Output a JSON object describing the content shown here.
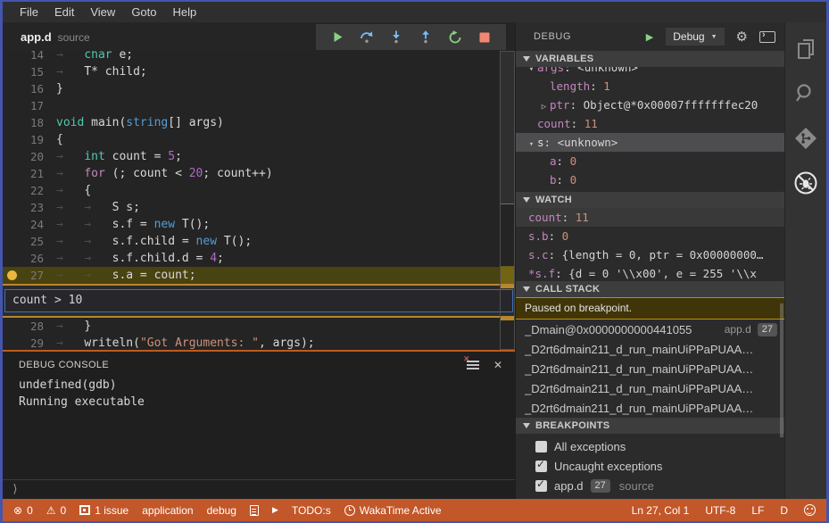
{
  "menu_bar": {
    "items": [
      "File",
      "Edit",
      "View",
      "Goto",
      "Help"
    ]
  },
  "editor": {
    "tab": {
      "title": "app.d",
      "type_label": "source"
    },
    "debug_toolbar": {
      "buttons": [
        "continue",
        "step-over",
        "step-into",
        "step-out",
        "restart",
        "stop"
      ]
    },
    "current_line": 27,
    "breakpoint_line": 27,
    "breakpoint_widget": {
      "condition": "count > 10",
      "after_line": 27
    },
    "code_lines": [
      {
        "num": 14,
        "tokens": [
          [
            "w",
            "→   "
          ],
          [
            "k",
            "char"
          ],
          [
            "p",
            " e;"
          ]
        ]
      },
      {
        "num": 15,
        "tokens": [
          [
            "w",
            "→   "
          ],
          [
            "p",
            "T* child;"
          ]
        ]
      },
      {
        "num": 16,
        "tokens": [
          [
            "p",
            "}"
          ]
        ]
      },
      {
        "num": 17,
        "tokens": []
      },
      {
        "num": 18,
        "tokens": [
          [
            "k",
            "void"
          ],
          [
            "p",
            " main("
          ],
          [
            "t",
            "string"
          ],
          [
            "p",
            "[] args)"
          ]
        ]
      },
      {
        "num": 19,
        "tokens": [
          [
            "p",
            "{"
          ]
        ]
      },
      {
        "num": 20,
        "tokens": [
          [
            "w",
            "→   "
          ],
          [
            "k",
            "int"
          ],
          [
            "p",
            " count = "
          ],
          [
            "n",
            "5"
          ],
          [
            "p",
            ";"
          ]
        ]
      },
      {
        "num": 21,
        "tokens": [
          [
            "w",
            "→   "
          ],
          [
            "c",
            "for"
          ],
          [
            "p",
            " (; count < "
          ],
          [
            "n",
            "20"
          ],
          [
            "p",
            "; count++)"
          ]
        ]
      },
      {
        "num": 22,
        "tokens": [
          [
            "w",
            "→   "
          ],
          [
            "p",
            "{"
          ]
        ]
      },
      {
        "num": 23,
        "tokens": [
          [
            "w",
            "→   "
          ],
          [
            "w",
            "→   "
          ],
          [
            "p",
            "S s;"
          ]
        ]
      },
      {
        "num": 24,
        "tokens": [
          [
            "w",
            "→   "
          ],
          [
            "w",
            "→   "
          ],
          [
            "p",
            "s.f = "
          ],
          [
            "t",
            "new"
          ],
          [
            "p",
            " T();"
          ]
        ]
      },
      {
        "num": 25,
        "tokens": [
          [
            "w",
            "→   "
          ],
          [
            "w",
            "→   "
          ],
          [
            "p",
            "s.f.child = "
          ],
          [
            "t",
            "new"
          ],
          [
            "p",
            " T();"
          ]
        ]
      },
      {
        "num": 26,
        "tokens": [
          [
            "w",
            "→   "
          ],
          [
            "w",
            "→   "
          ],
          [
            "p",
            "s.f.child.d = "
          ],
          [
            "n",
            "4"
          ],
          [
            "p",
            ";"
          ]
        ]
      },
      {
        "num": 27,
        "tokens": [
          [
            "w",
            "→   "
          ],
          [
            "w",
            "→   "
          ],
          [
            "p",
            "s.a = count;"
          ]
        ]
      },
      {
        "num": 28,
        "tokens": [
          [
            "w",
            "→   "
          ],
          [
            "p",
            "}"
          ]
        ]
      },
      {
        "num": 29,
        "tokens": [
          [
            "w",
            "→   "
          ],
          [
            "p",
            "writeln("
          ],
          [
            "s",
            "\"Got Arguments: \""
          ],
          [
            "p",
            ", args);"
          ]
        ]
      }
    ]
  },
  "debug_panel": {
    "title": "DEBUG",
    "config_dropdown": "Debug",
    "variables": {
      "title": "VARIABLES",
      "rows": [
        {
          "indent": 1,
          "twisty": "open",
          "key": "args",
          "key_style": "key",
          "value": "<unknown>",
          "value_style": "plain",
          "clip_top": true
        },
        {
          "indent": 2,
          "twisty": "none",
          "key": "length",
          "key_style": "key",
          "value": "1",
          "value_style": "num"
        },
        {
          "indent": 2,
          "twisty": "closed",
          "key": "ptr",
          "key_style": "key",
          "value": "Object@*0x00007fffffffec20",
          "value_style": "plain"
        },
        {
          "indent": 1,
          "twisty": "none",
          "key": "count",
          "key_style": "key",
          "value": "11",
          "value_style": "num"
        },
        {
          "indent": 1,
          "twisty": "open",
          "key": "s",
          "key_style": "plain",
          "value": "<unknown>",
          "value_style": "plain",
          "selected": true
        },
        {
          "indent": 2,
          "twisty": "none",
          "key": "a",
          "key_style": "key",
          "value": "0",
          "value_style": "num"
        },
        {
          "indent": 2,
          "twisty": "none",
          "key": "b",
          "key_style": "key",
          "value": "0",
          "value_style": "num"
        }
      ]
    },
    "watch": {
      "title": "WATCH",
      "rows": [
        {
          "key": "count",
          "value": "11",
          "value_style": "num",
          "highlighted": true
        },
        {
          "key": "s.b",
          "value": "0",
          "value_style": "num"
        },
        {
          "key": "s.c",
          "value": "{length = 0, ptr = 0x00000000…",
          "value_style": "plain"
        },
        {
          "key": "*s.f",
          "value": "{d = 0 '\\\\x00', e = 255 '\\\\x",
          "value_style": "plain"
        }
      ]
    },
    "call_stack": {
      "title": "CALL STACK",
      "status": "Paused on breakpoint.",
      "frames": [
        {
          "label": "_Dmain@0x0000000000441055",
          "file": "app.d",
          "line_badge": "27"
        },
        {
          "label": "_D2rt6dmain211_d_run_mainUiPPaPUAA…"
        },
        {
          "label": "_D2rt6dmain211_d_run_mainUiPPaPUAA…"
        },
        {
          "label": "_D2rt6dmain211_d_run_mainUiPPaPUAA…"
        },
        {
          "label": "_D2rt6dmain211_d_run_mainUiPPaPUAA…"
        }
      ]
    },
    "breakpoints": {
      "title": "BREAKPOINTS",
      "items": [
        {
          "checked": false,
          "label": "All exceptions"
        },
        {
          "checked": true,
          "label": "Uncaught exceptions"
        },
        {
          "checked": true,
          "label": "app.d",
          "badge": "27",
          "detail": "source"
        }
      ]
    }
  },
  "debug_console": {
    "title": "DEBUG CONSOLE",
    "output": [
      "undefined(gdb)",
      "Running executable"
    ],
    "prompt": "⟩"
  },
  "activity_bar": {
    "items": [
      {
        "name": "explorer"
      },
      {
        "name": "search"
      },
      {
        "name": "source-control"
      },
      {
        "name": "debug",
        "active": true
      }
    ]
  },
  "status_bar": {
    "left": [
      {
        "icon": "error-circle",
        "label": "0"
      },
      {
        "icon": "warning-triangle",
        "label": "0"
      },
      {
        "icon": "issues-frame",
        "label": "1 issue"
      },
      {
        "label": "application"
      },
      {
        "label": "debug"
      },
      {
        "icon": "document"
      },
      {
        "icon": "play"
      },
      {
        "label": "TODO:s"
      },
      {
        "icon": "clock",
        "label": "WakaTime Active"
      }
    ],
    "right": [
      {
        "label": "Ln 27, Col 1"
      },
      {
        "label": "UTF-8"
      },
      {
        "label": "LF"
      },
      {
        "label": "D"
      },
      {
        "icon": "smiley"
      }
    ]
  },
  "colors": {
    "window_frame": "#4455ad",
    "status_bar_bg": "#c2572a",
    "current_line_bg": "#494211",
    "breakpoint_dot": "#ebb63d",
    "widget_border": "#b8872b",
    "panel_border": "#bf5b1e",
    "keyword": "#4EC9B0",
    "type_keyword": "#569CD6",
    "control_keyword": "#C586C0",
    "number": "#B168C8",
    "string": "#CE9178",
    "variable_key": "#C586C0",
    "value_number": "#CE9178",
    "play_green": "#89D185",
    "step_blue": "#75BEFF",
    "stop_red": "#F48771"
  }
}
